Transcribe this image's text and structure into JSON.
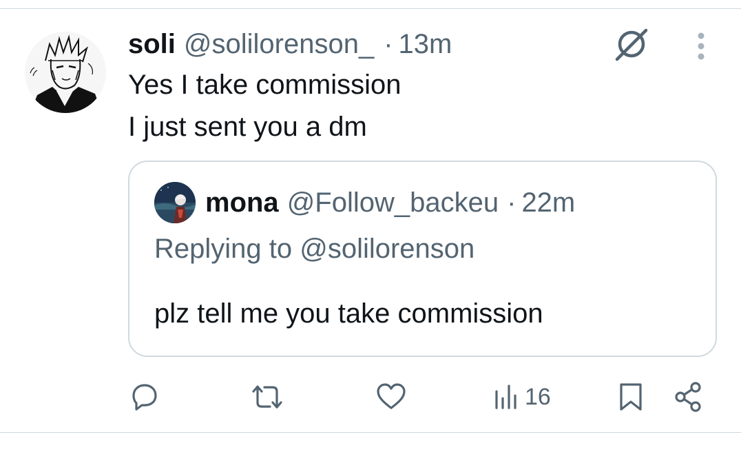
{
  "tweet": {
    "author_name": "soli",
    "author_handle": "@solilorenson_",
    "separator": "·",
    "time": "13m",
    "lines": [
      "Yes I take commission",
      "I just sent you a dm"
    ]
  },
  "quote": {
    "author_name": "mona",
    "author_handle": "@Follow_backeu",
    "separator": "·",
    "time": "22m",
    "replying_to": "Replying to @solilorenson",
    "text": "plz tell me you take commission"
  },
  "actions": {
    "views_count": "16",
    "icons": [
      "reply-icon",
      "retweet-icon",
      "like-icon",
      "views-icon",
      "bookmark-icon",
      "share-icon"
    ]
  },
  "icons": {
    "grok": "grok-icon",
    "more": "more-icon"
  },
  "colors": {
    "text": "#0f1419",
    "secondary": "#536471",
    "border": "#cfd9de",
    "icon": "#536471"
  }
}
